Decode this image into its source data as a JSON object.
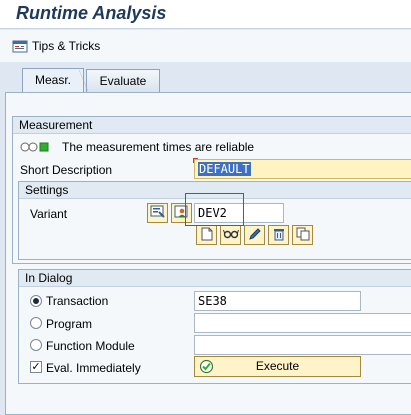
{
  "title": "Runtime Analysis",
  "toolbar": {
    "tips_label": "Tips & Tricks"
  },
  "tabs": [
    {
      "label": "Measr.",
      "active": true
    },
    {
      "label": "Evaluate",
      "active": false
    }
  ],
  "measurement": {
    "heading": "Measurement",
    "status_text": "The measurement times are reliable",
    "short_desc_label": "Short Description",
    "short_desc_value": "DEFAULT",
    "settings": {
      "heading": "Settings",
      "variant_label": "Variant",
      "variant_value": "DEV2"
    }
  },
  "in_dialog": {
    "heading": "In Dialog",
    "transaction_label": "Transaction",
    "transaction_value": "SE38",
    "program_label": "Program",
    "program_value": "",
    "function_module_label": "Function Module",
    "function_module_value": "",
    "eval_label": "Eval. Immediately",
    "eval_checked": true,
    "execute_label": "Execute"
  },
  "colors": {
    "button_bg": "#fff4c9",
    "highlight": "#e02424",
    "status_green": "#2fae2f"
  }
}
